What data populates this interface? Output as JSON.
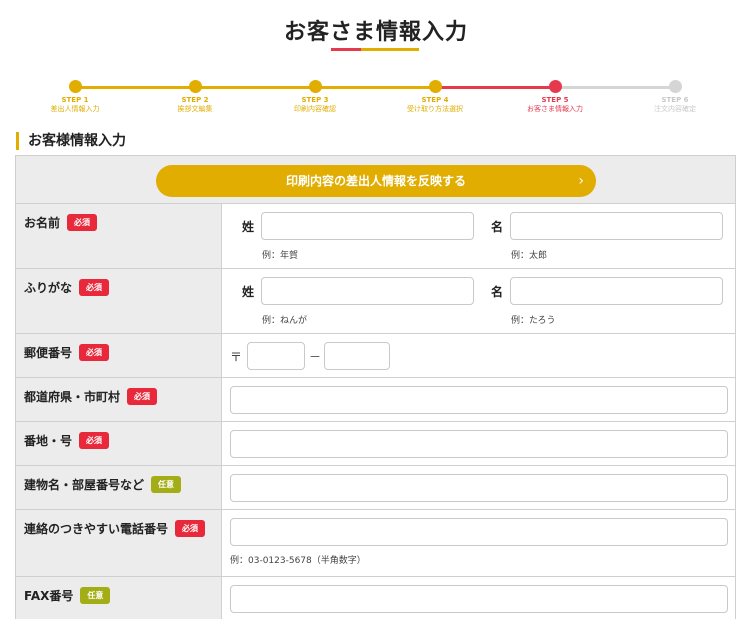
{
  "page": {
    "title": "お客さま情報入力"
  },
  "colors": {
    "accent_yellow": "#e0ad00",
    "accent_red": "#e53a4e",
    "required_red": "#e8283b",
    "optional_green": "#a3ad16",
    "inactive_gray": "#cccccc"
  },
  "steps": [
    {
      "num": "STEP 1",
      "label": "差出人情報入力",
      "state": "done"
    },
    {
      "num": "STEP 2",
      "label": "挨拶文編集",
      "state": "done"
    },
    {
      "num": "STEP 3",
      "label": "印刷内容確認",
      "state": "done"
    },
    {
      "num": "STEP 4",
      "label": "受け取り方法選択",
      "state": "done"
    },
    {
      "num": "STEP 5",
      "label": "お客さま情報入力",
      "state": "current"
    },
    {
      "num": "STEP 6",
      "label": "注文内容確定",
      "state": "todo"
    }
  ],
  "section": {
    "heading": "お客様情報入力"
  },
  "reflect_button": {
    "label": "印刷内容の差出人情報を反映する",
    "icon": "chevron-right-icon",
    "glyph": "›"
  },
  "badges": {
    "required": "必須",
    "optional": "任意"
  },
  "fields": {
    "name": {
      "label": "お名前",
      "last_label": "姓",
      "first_label": "名",
      "last_example": "例：年賀",
      "first_example": "例：太郎",
      "last_value": "",
      "first_value": ""
    },
    "kana": {
      "label": "ふりがな",
      "last_label": "姓",
      "first_label": "名",
      "last_example": "例：ねんが",
      "first_example": "例：たろう",
      "last_value": "",
      "first_value": ""
    },
    "postal": {
      "label": "郵便番号",
      "mark": "〒",
      "dash": "－",
      "part1": "",
      "part2": ""
    },
    "prefecture": {
      "label": "都道府県・市町村",
      "value": ""
    },
    "address": {
      "label": "番地・号",
      "value": ""
    },
    "building": {
      "label": "建物名・部屋番号など",
      "value": ""
    },
    "phone": {
      "label": "連絡のつきやすい電話番号",
      "example": "例：03-0123-5678（半角数字）",
      "value": ""
    },
    "fax": {
      "label": "FAX番号",
      "value": ""
    }
  }
}
